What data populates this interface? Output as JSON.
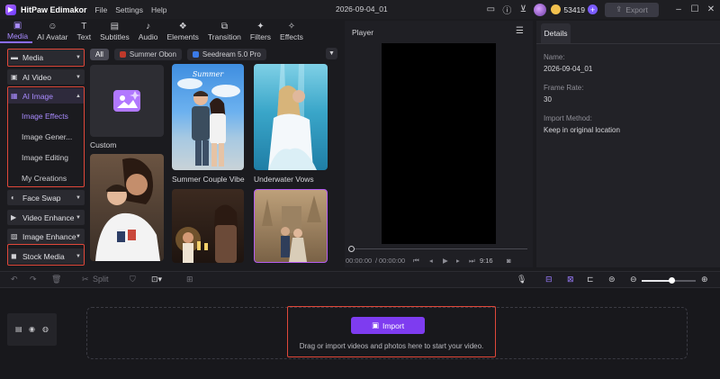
{
  "titlebar": {
    "app_name": "HitPaw Edimakor",
    "menu": [
      "File",
      "Settings",
      "Help"
    ],
    "project_title": "2026-09-04_01",
    "coins": "53419",
    "export_label": "Export"
  },
  "toolbar": {
    "tabs": [
      {
        "label": "Media",
        "icon": "media-icon",
        "glyph": "▣"
      },
      {
        "label": "AI Avatar",
        "icon": "ai-avatar-icon",
        "glyph": "☺"
      },
      {
        "label": "Text",
        "icon": "text-icon",
        "glyph": "T"
      },
      {
        "label": "Subtitles",
        "icon": "subtitles-icon",
        "glyph": "▤"
      },
      {
        "label": "Audio",
        "icon": "audio-icon",
        "glyph": "♪"
      },
      {
        "label": "Elements",
        "icon": "elements-icon",
        "glyph": "❖"
      },
      {
        "label": "Transition",
        "icon": "transition-icon",
        "glyph": "⧉"
      },
      {
        "label": "Filters",
        "icon": "filters-icon",
        "glyph": "✦"
      },
      {
        "label": "Effects",
        "icon": "effects-icon",
        "glyph": "✧"
      }
    ]
  },
  "sidebar": {
    "media": "Media",
    "ai_video": "AI Video",
    "ai_image": "AI Image",
    "ai_image_subitems": [
      "Image Effects",
      "Image Gener...",
      "Image Editing",
      "My Creations"
    ],
    "face_swap": "Face Swap",
    "video_enhance": "Video Enhance",
    "image_enhance": "Image Enhance",
    "stock_media": "Stock Media"
  },
  "filters": {
    "all": "All",
    "summer_obon": "Summer Obon",
    "seedream": "Seedream 5.0 Pro"
  },
  "cards": {
    "custom": "Custom",
    "summer_couple": "Summer Couple Vibe",
    "underwater_vows": "Underwater Vows"
  },
  "player": {
    "title": "Player",
    "time_current": "00:00:00",
    "time_total": "00:00:00",
    "duration": "9:16"
  },
  "details": {
    "tab": "Details",
    "name_label": "Name:",
    "name_value": "2026-09-04_01",
    "framerate_label": "Frame Rate:",
    "framerate_value": "30",
    "import_label": "Import Method:",
    "import_value": "Keep in original location"
  },
  "timeline": {
    "split_label": "Split",
    "import_label": "Import",
    "import_hint": "Drag or import videos and photos here to start your video.",
    "zoom_level": 0.55
  },
  "colors": {
    "accent": "#8a6cff",
    "highlight": "#e0483a",
    "import_button": "#7e3cf0"
  }
}
